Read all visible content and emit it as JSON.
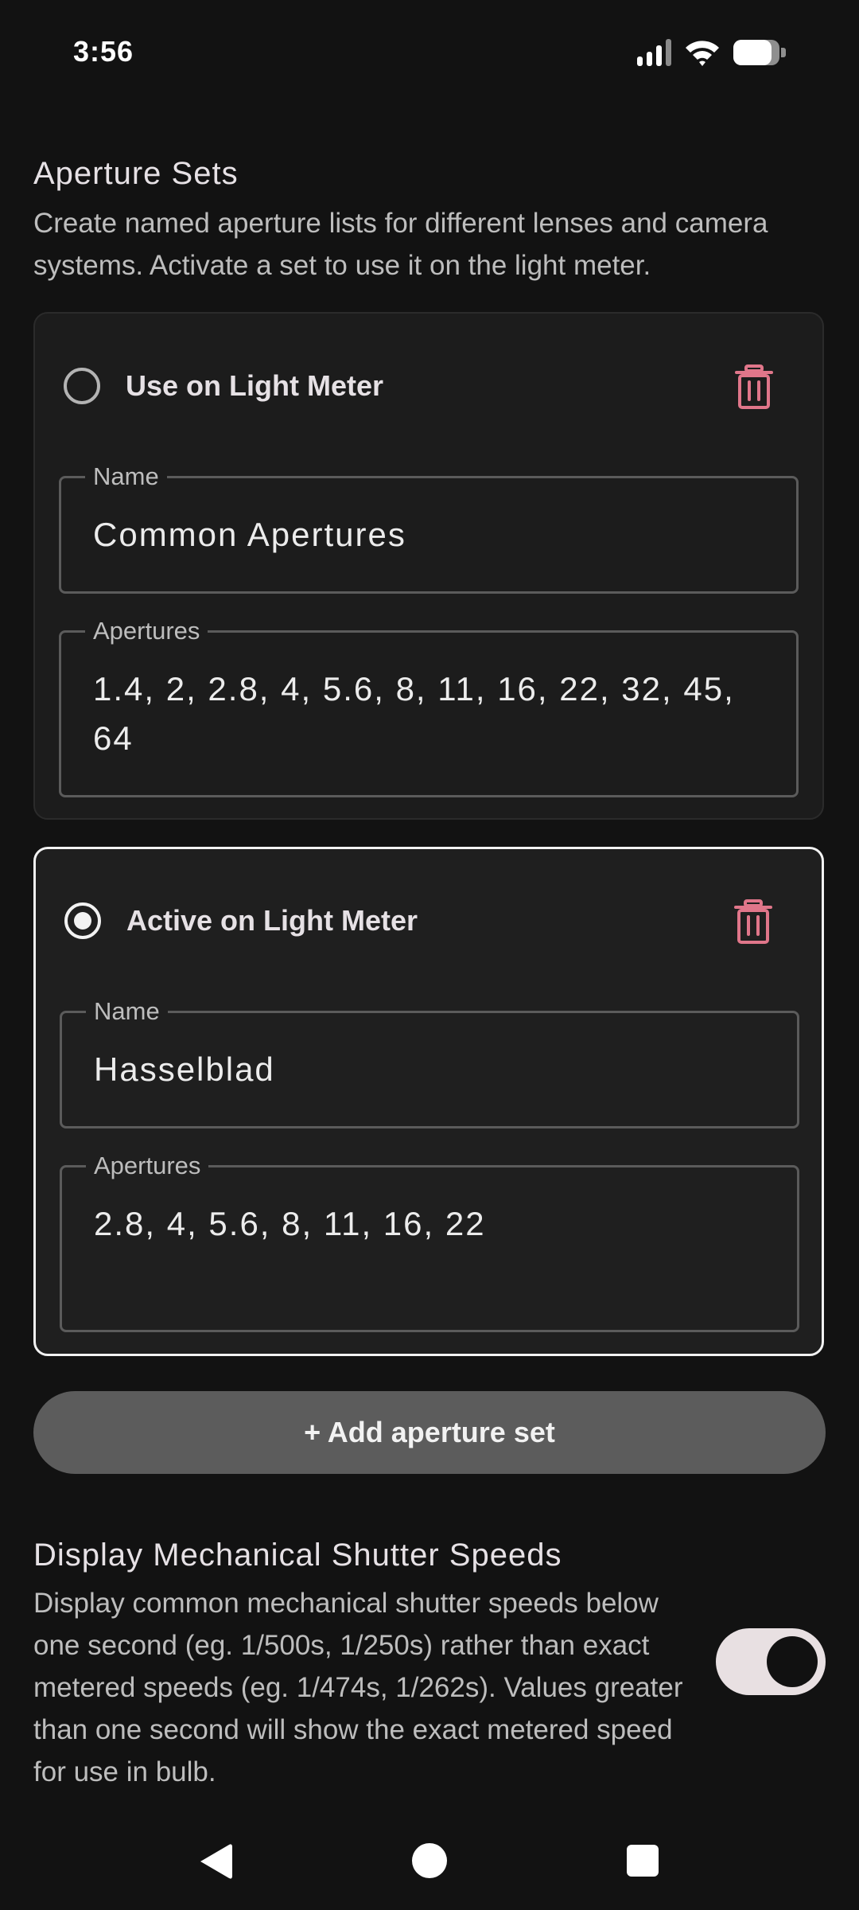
{
  "status_bar": {
    "time": "3:56"
  },
  "aperture_section": {
    "title": "Aperture Sets",
    "description": "Create named aperture lists for different lenses and camera systems. Activate a set to use it on the light meter."
  },
  "aperture_sets": [
    {
      "radio_label": "Use on Light Meter",
      "selected": false,
      "name_label": "Name",
      "name_value": "Common Apertures",
      "apertures_label": "Apertures",
      "apertures_value": "1.4, 2, 2.8, 4, 5.6, 8, 11, 16, 22, 32, 45, 64"
    },
    {
      "radio_label": "Active on Light Meter",
      "selected": true,
      "name_label": "Name",
      "name_value": "Hasselblad",
      "apertures_label": "Apertures",
      "apertures_value": "2.8, 4, 5.6, 8, 11, 16, 22"
    }
  ],
  "add_button": {
    "label": "+ Add aperture set"
  },
  "shutter_setting": {
    "title": "Display Mechanical Shutter Speeds",
    "description": "Display common mechanical shutter speeds below one second (eg. 1/500s, 1/250s) rather than exact metered speeds (eg. 1/474s, 1/262s). Values greater than one second will show the exact metered speed for use in bulb.",
    "enabled": true
  },
  "colors": {
    "background": "#121212",
    "delete_accent": "#e0768a",
    "button_bg": "#5c5c5c",
    "toggle_track": "#e8e0e2"
  },
  "icons": {
    "delete": "trash-icon",
    "wifi": "wifi-icon",
    "signal": "cellular-signal-icon",
    "battery": "battery-icon",
    "back": "back-triangle-icon",
    "home": "home-circle-icon",
    "recents": "recents-square-icon"
  }
}
